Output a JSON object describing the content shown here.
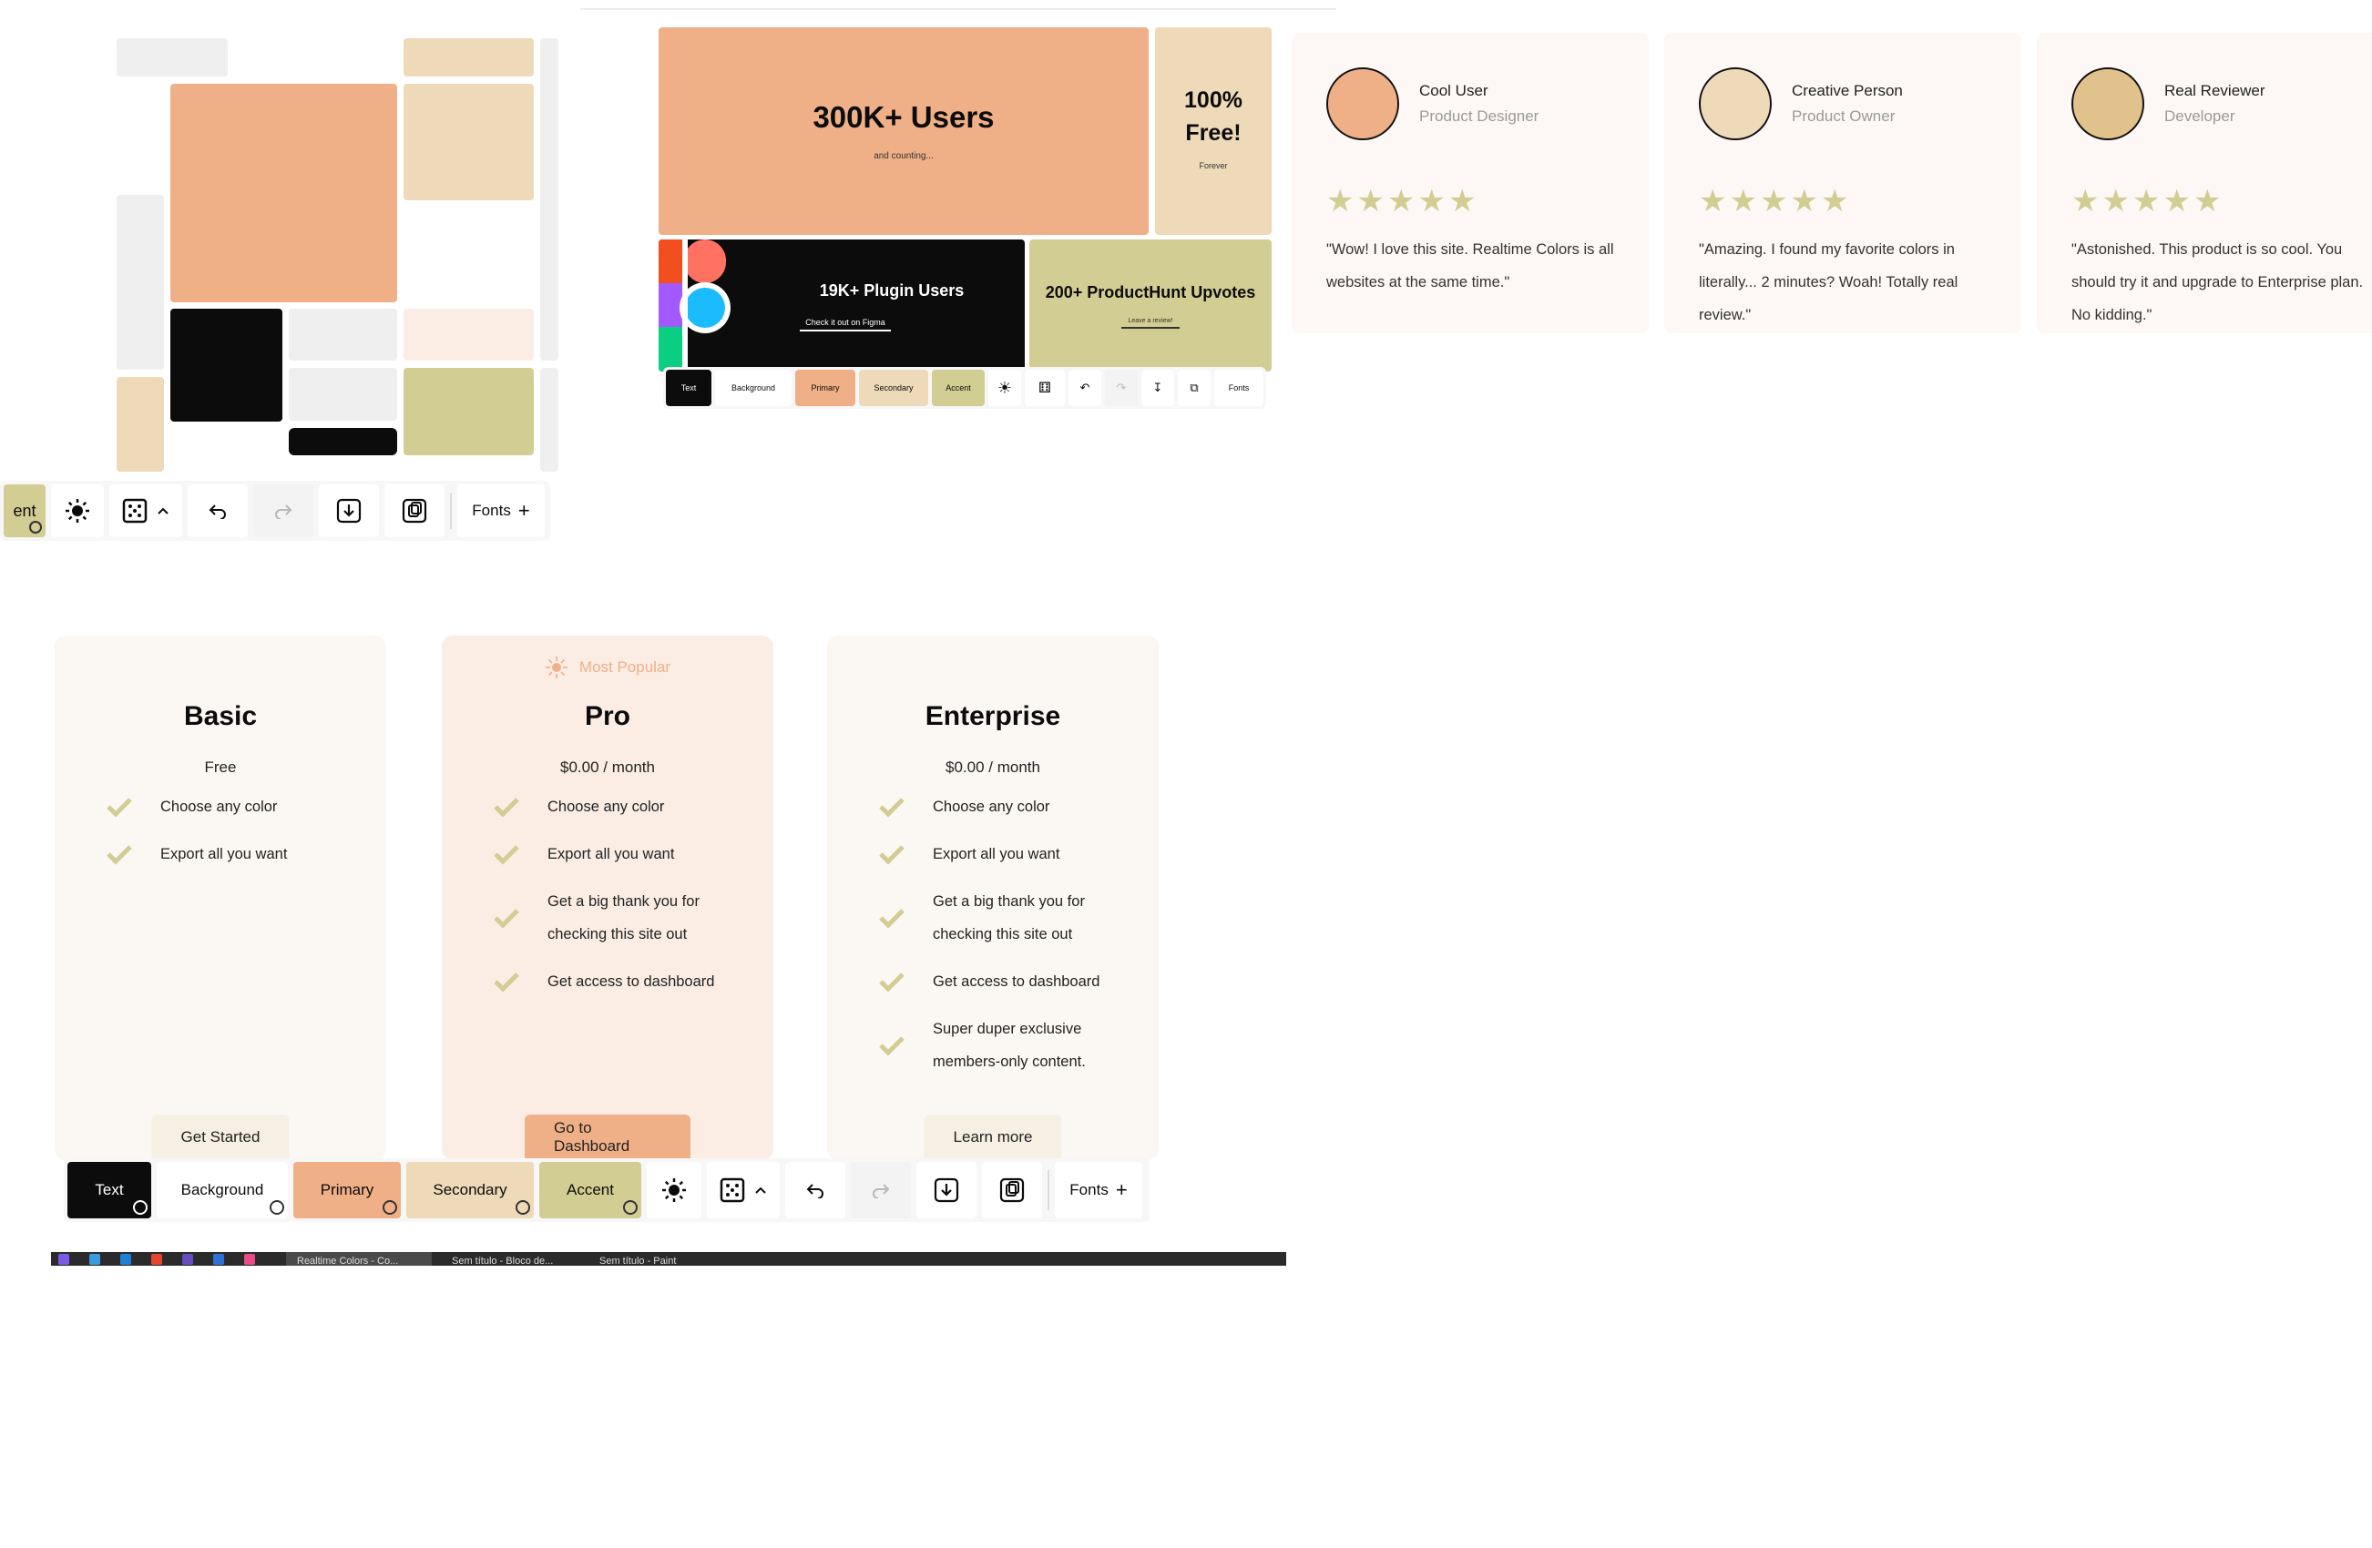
{
  "colors": {
    "text": "#0c0c0c",
    "background": "#ffffff",
    "primary": "#efb087",
    "secondary": "#eed9b8",
    "accent": "#d2cd93",
    "light_gray": "#efefef",
    "card_bg": "#fbf8f4",
    "pro_bg": "#fbede4"
  },
  "hero": {
    "users_title": "300K+ Users",
    "users_sub": "and counting...",
    "free_title": "100% Free!",
    "free_sub": "Forever",
    "plugin_title": "19K+ Plugin Users",
    "plugin_link": "Check it out on Figma",
    "ph_title": "200+ ProductHunt Upvotes",
    "ph_link": "Leave a review!"
  },
  "toolbar": {
    "text": "Text",
    "background": "Background",
    "primary": "Primary",
    "secondary": "Secondary",
    "accent": "Accent",
    "fonts": "Fonts",
    "accent_fragment": "ent",
    "icons": [
      "sun-icon",
      "dice-icon",
      "chevron-up-icon",
      "undo-icon",
      "redo-icon",
      "download-icon",
      "copy-icon",
      "plus-icon"
    ]
  },
  "testimonials": [
    {
      "name": "Cool User",
      "role": "Product Designer",
      "quote": "\"Wow! I love this site. Realtime Colors is all websites at the same time.\"",
      "avatar_color": "#efb087"
    },
    {
      "name": "Creative Person",
      "role": "Product Owner",
      "quote": "\"Amazing. I found my favorite colors in literally... 2 minutes? Woah! Totally real review.\"",
      "avatar_color": "#eed9b8"
    },
    {
      "name": "Real Reviewer",
      "role": "Developer",
      "quote": "\"Astonished. This product is so cool. You should try it and upgrade to Enterprise plan. No kidding.\"",
      "avatar_color": "#e2c28c"
    }
  ],
  "pricing": {
    "popular_label": "Most Popular",
    "plans": [
      {
        "title": "Basic",
        "price": "Free",
        "features": [
          "Choose any color",
          "Export all you want"
        ],
        "cta": "Get Started"
      },
      {
        "title": "Pro",
        "price": "$0.00 / month",
        "features": [
          "Choose any color",
          "Export all you want",
          "Get a big thank you for checking this site out",
          "Get access to dashboard"
        ],
        "cta": "Go to Dashboard"
      },
      {
        "title": "Enterprise",
        "price": "$0.00 / month",
        "features": [
          "Choose any color",
          "Export all you want",
          "Get a big thank you for checking this site out",
          "Get access to dashboard",
          "Super duper exclusive members-only content."
        ],
        "cta": "Learn more"
      }
    ]
  },
  "taskbar": {
    "tabs": [
      "Realtime Colors - Co...",
      "Sem título - Bloco de...",
      "Sem título - Paint"
    ]
  }
}
